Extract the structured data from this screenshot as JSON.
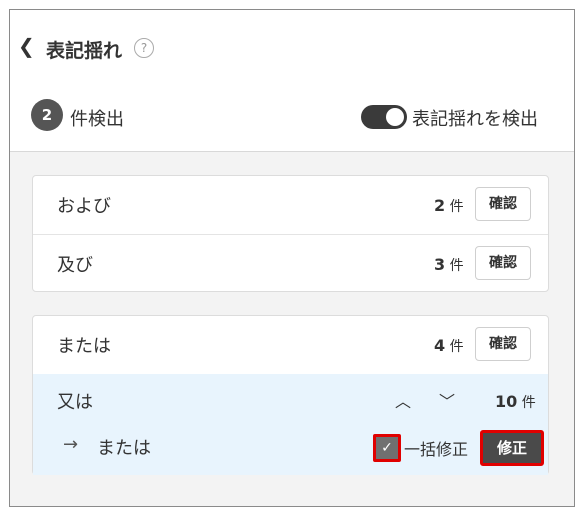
{
  "header": {
    "back_icon": "chevron-left-icon",
    "title": "表記揺れ",
    "help_icon": "question-circle-icon",
    "help_glyph": "?",
    "detected_count": "2",
    "detected_label": "件検出",
    "toggle_label": "表記揺れを検出",
    "toggle_on": true
  },
  "groups": [
    {
      "items": [
        {
          "word": "および",
          "count": "2",
          "unit": "件",
          "confirm_label": "確認"
        },
        {
          "word": "及び",
          "count": "3",
          "unit": "件",
          "confirm_label": "確認"
        }
      ]
    },
    {
      "items": [
        {
          "word": "または",
          "count": "4",
          "unit": "件",
          "confirm_label": "確認"
        }
      ],
      "expanded_item": {
        "word": "又は",
        "count": "10",
        "unit": "件",
        "up_glyph": "︿",
        "down_glyph": "﹀",
        "arrow_glyph": "→",
        "replacement": "または",
        "bulk_checked": true,
        "check_glyph": "✓",
        "bulk_label": "一括修正",
        "fix_label": "修正"
      }
    }
  ],
  "colors": {
    "badge_bg": "#555555",
    "highlight_bg": "#e8f4fd",
    "annotation_red": "#e00000"
  }
}
